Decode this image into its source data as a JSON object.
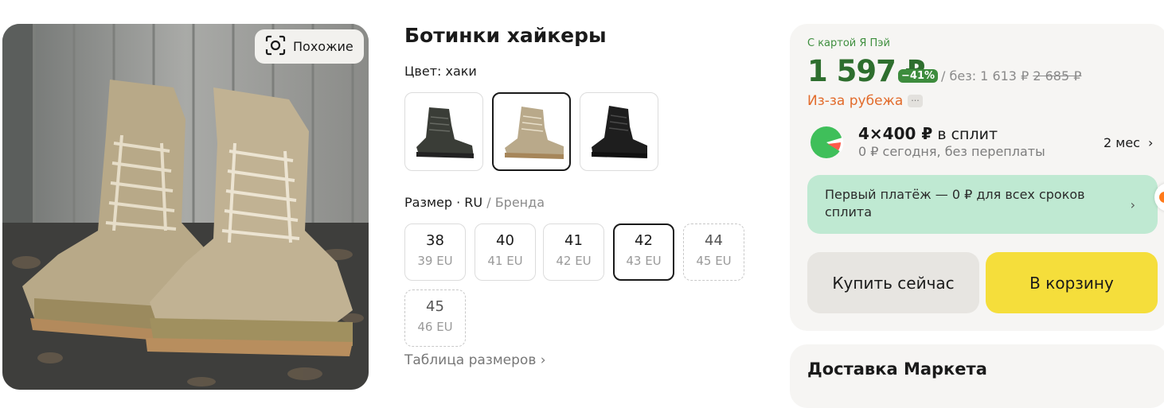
{
  "product": {
    "title": "Ботинки хайкеры",
    "similar_label": "Похожие",
    "color_label": "Цвет: хаки",
    "colors": [
      {
        "name": "black-olive",
        "hex": "#3a3d37"
      },
      {
        "name": "khaki",
        "hex": "#b9a98a",
        "selected": true
      },
      {
        "name": "black",
        "hex": "#1e1e1e"
      }
    ],
    "size_header": {
      "prefix": "Размер · ",
      "active": "RU",
      "sep": " / ",
      "alt": "Бренда"
    },
    "sizes": [
      {
        "ru": "38",
        "eu": "39 EU",
        "state": "normal"
      },
      {
        "ru": "40",
        "eu": "41 EU",
        "state": "normal"
      },
      {
        "ru": "41",
        "eu": "42 EU",
        "state": "normal"
      },
      {
        "ru": "42",
        "eu": "43 EU",
        "state": "selected"
      },
      {
        "ru": "44",
        "eu": "45 EU",
        "state": "unavailable"
      },
      {
        "ru": "45",
        "eu": "46 EU",
        "state": "unavailable"
      }
    ],
    "size_table_link": "Таблица размеров ›"
  },
  "offer": {
    "card_label": "С картой Я Пэй",
    "price": "1 597 ₽",
    "discount": "−41%",
    "old_price_prefix": "/ без: 1 613 ₽",
    "old_price_crossed": "2 685 ₽",
    "origin": "Из-за рубежа",
    "origin_more": "···",
    "split": {
      "main_bold": "4×400 ₽",
      "main_rest": " в сплит",
      "sub": "0 ₽ сегодня, без переплаты",
      "months": "2 мес",
      "months_chevron": "›"
    },
    "promo_text": "Первый платёж — 0 ₽ для всех сроков сплита",
    "promo_chevron": "›",
    "buy_now": "Купить сейчас",
    "add_to_cart": "В корзину"
  },
  "delivery": {
    "title": "Доставка Маркета"
  },
  "colors": {
    "price_green": "#2e6e2e",
    "discount_bg": "#3d8c3d",
    "origin_orange": "#e26b2b",
    "cart_yellow": "#f5de3b",
    "promo_mint": "#bfe9d2"
  }
}
